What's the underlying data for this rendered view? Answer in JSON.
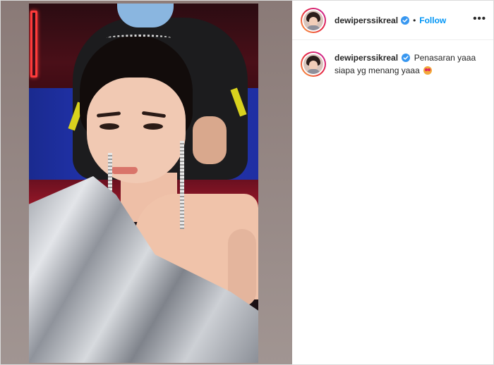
{
  "post": {
    "username": "dewiperssikreal",
    "follow_label": "Follow",
    "separator": "•",
    "more_label": "•••",
    "caption": {
      "username": "dewiperssikreal",
      "text": "Penasaran yaaa siapa yg menang yaaa",
      "emoji": "star-struck-emoji"
    },
    "verified_icon": "verified-badge-icon",
    "colors": {
      "follow": "#0095f6",
      "verified": "#3897f0",
      "avatar_ring_start": "#f9a13b",
      "avatar_ring_end": "#c724a6"
    }
  }
}
